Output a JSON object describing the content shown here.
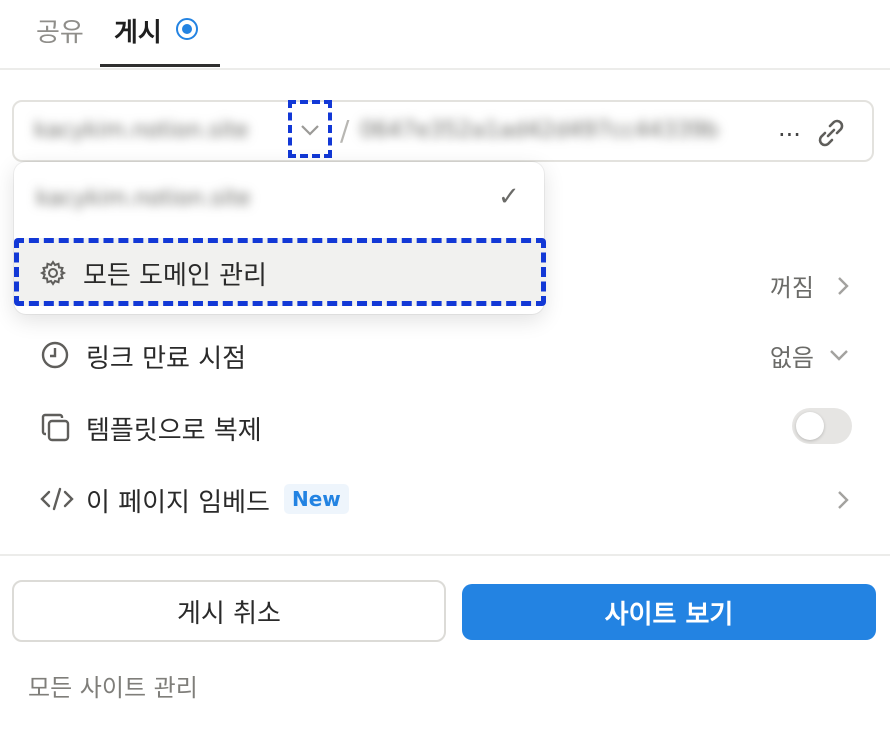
{
  "tabs": {
    "share": "공유",
    "publish": "게시"
  },
  "url_bar": {
    "domain": "kacykim.notion.site",
    "separator": "/",
    "path": "0647e352a1ad42d497cc44339b",
    "ellipsis": "..."
  },
  "dropdown": {
    "domain_option": "kacykim.notion.site",
    "check_mark": "✓",
    "manage_domains": "모든 도메인 관리"
  },
  "settings": {
    "search_engine": {
      "value": "꺼짐"
    },
    "link_expiry": {
      "label": "링크 만료 시점",
      "value": "없음"
    },
    "duplicate_template": {
      "label": "템플릿으로 복제",
      "enabled": false
    },
    "embed_page": {
      "label": "이 페이지 임베드",
      "badge": "New"
    }
  },
  "actions": {
    "unpublish": "게시 취소",
    "view_site": "사이트 보기"
  },
  "footer": {
    "manage_sites": "모든 사이트 관리"
  },
  "colors": {
    "accent": "#2383e2",
    "annotation": "#1238d6"
  }
}
